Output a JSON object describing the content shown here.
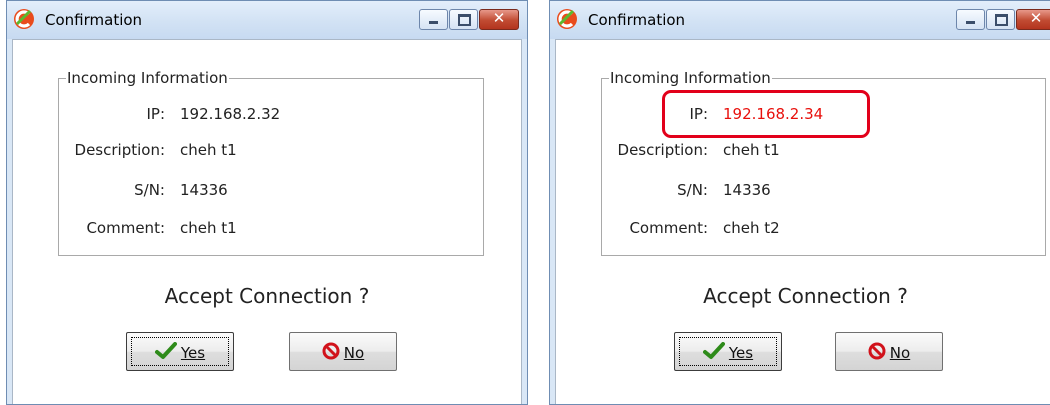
{
  "dialogs": [
    {
      "title": "Confirmation",
      "icon": "app-logo-icon",
      "group_title": "Incoming Information",
      "fields": [
        {
          "label": "IP:",
          "value": "192.168.2.32"
        },
        {
          "label": "Description:",
          "value": "cheh t1"
        },
        {
          "label": "S/N:",
          "value": "14336"
        },
        {
          "label": "Comment:",
          "value": "cheh t1"
        }
      ],
      "question": "Accept Connection ?",
      "yes_button": {
        "label": "Yes",
        "mnemonic": "Y",
        "icon": "checkmark-icon"
      },
      "no_button": {
        "label": "No",
        "mnemonic": "N",
        "icon": "no-entry-icon"
      },
      "caption_buttons": {
        "minimize": "minimize-icon",
        "maximize": "maximize-icon",
        "close": "close-icon"
      }
    },
    {
      "title": "Confirmation",
      "icon": "app-logo-icon",
      "group_title": "Incoming Information",
      "fields": [
        {
          "label": "IP:",
          "value": "192.168.2.34"
        },
        {
          "label": "Description:",
          "value": "cheh t1"
        },
        {
          "label": "S/N:",
          "value": "14336"
        },
        {
          "label": "Comment:",
          "value": "cheh t2"
        }
      ],
      "question": "Accept Connection ?",
      "yes_button": {
        "label": "Yes",
        "mnemonic": "Y",
        "icon": "checkmark-icon"
      },
      "no_button": {
        "label": "No",
        "mnemonic": "N",
        "icon": "no-entry-icon"
      },
      "caption_buttons": {
        "minimize": "minimize-icon",
        "maximize": "maximize-icon",
        "close": "close-icon"
      }
    }
  ],
  "colors": {
    "changed_value": "#e8100c",
    "highlight_box": "#e2001a",
    "titlebar": "#d2e2f4",
    "close_button": "#c14b32",
    "checkmark": "#2e8b1a",
    "no_entry": "#d1121b"
  }
}
